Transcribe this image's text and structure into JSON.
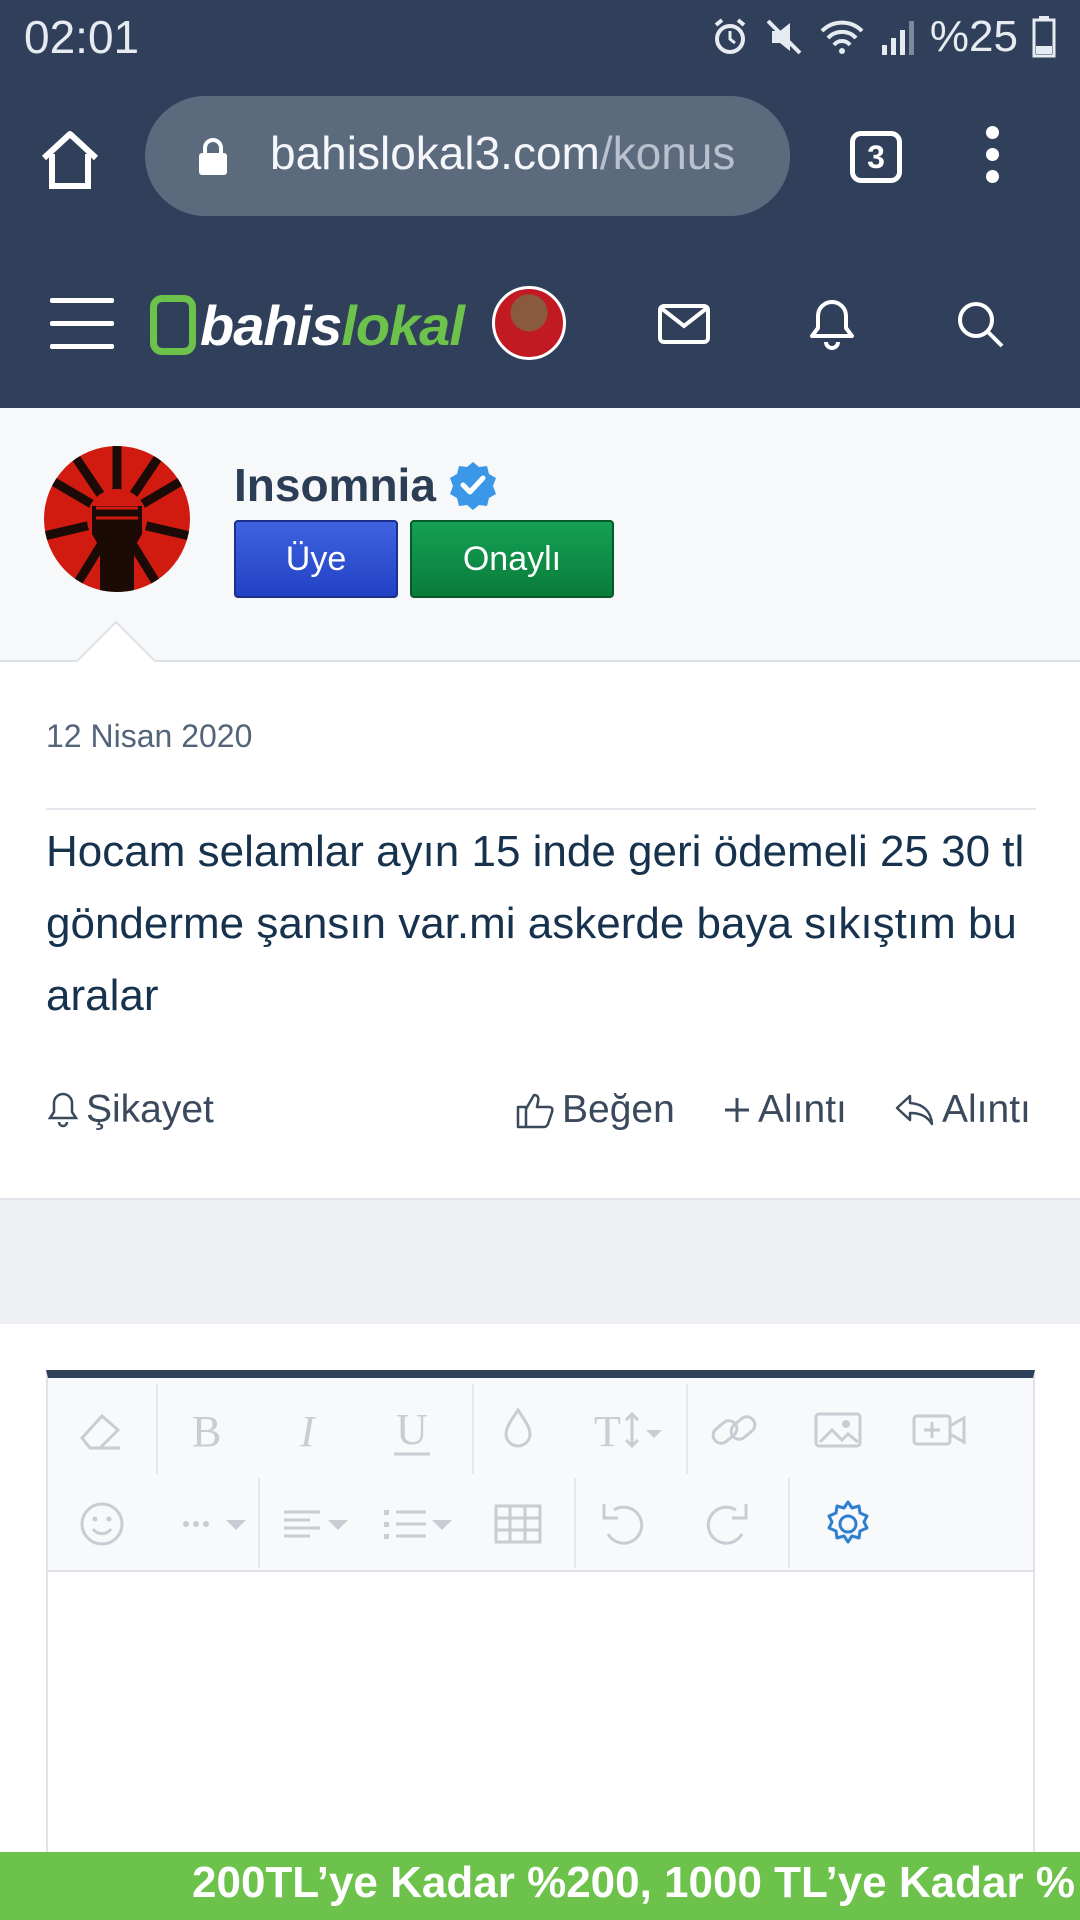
{
  "status_bar": {
    "time": "02:01",
    "battery": "%25",
    "icons": [
      "alarm-icon",
      "mute-icon",
      "wifi-icon",
      "signal-icon",
      "battery-icon"
    ]
  },
  "browser": {
    "url_host": "bahislokal3.com",
    "url_rest": "/konus",
    "tab_count": "3"
  },
  "site": {
    "logo_part1": "bahis",
    "logo_part2": "lokal",
    "accent_color": "#6cc24a",
    "header_color": "#30405a"
  },
  "user": {
    "name": "Insomnia",
    "badges": [
      "Üye",
      "Onaylı"
    ]
  },
  "post": {
    "date": "12 Nisan 2020",
    "body": "Hocam selamlar ayın 15 inde geri ödemeli 25 30 tl gönderme şansın var.mi askerde baya sıkıştım bu aralar",
    "actions": {
      "report": "Şikayet",
      "like": "Beğen",
      "multiquote": "Alıntı",
      "reply": "Alıntı"
    }
  },
  "editor": {
    "toolbar_row1": [
      "eraser-icon",
      "bold-icon",
      "italic-icon",
      "underline-icon",
      "color-icon",
      "text-size-icon",
      "link-icon",
      "image-icon",
      "video-icon"
    ],
    "toolbar_row2": [
      "emoji-icon",
      "more-icon",
      "align-icon",
      "list-icon",
      "table-icon",
      "undo-icon",
      "redo-icon",
      "settings-icon"
    ]
  },
  "banner": {
    "text": "200TL’ye Kadar %200, 1000 TL’ye Kadar %"
  }
}
